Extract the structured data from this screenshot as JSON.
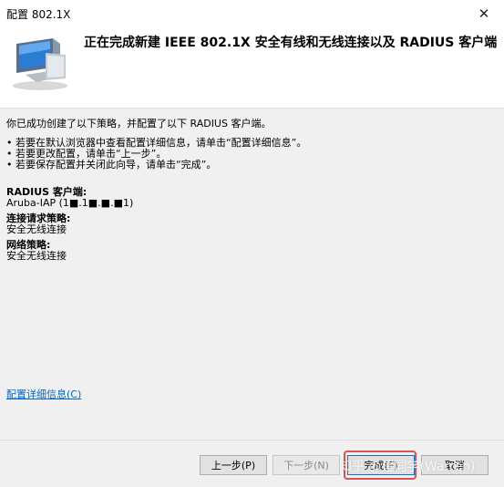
{
  "window": {
    "title": "配置 802.1X"
  },
  "header": {
    "title": "正在完成新建 IEEE 802.1X 安全有线和无线连接以及 RADIUS 客户端"
  },
  "content": {
    "intro": "你已成功创建了以下策略，并配置了以下 RADIUS 客户端。",
    "bullets": [
      "• 若要在默认浏览器中查看配置详细信息，请单击“配置详细信息”。",
      "• 若要更改配置，请单击“上一步”。",
      "• 若要保存配置并关闭此向导，请单击“完成”。"
    ],
    "radius": {
      "heading": "RADIUS 客户端:",
      "value": "Aruba-IAP (1■.1■.■.■1)"
    },
    "connection_policy": {
      "heading": "连接请求策略:",
      "value": "安全无线连接"
    },
    "network_policy": {
      "heading": "网络策略:",
      "value": "安全无线连接"
    },
    "details_link": "配置详细信息(C)"
  },
  "footer": {
    "back": "上一步(P)",
    "next": "下一步(N)",
    "finish": "完成(F)",
    "cancel": "取消"
  },
  "watermark": "知乎 @建同学(Warren)"
}
